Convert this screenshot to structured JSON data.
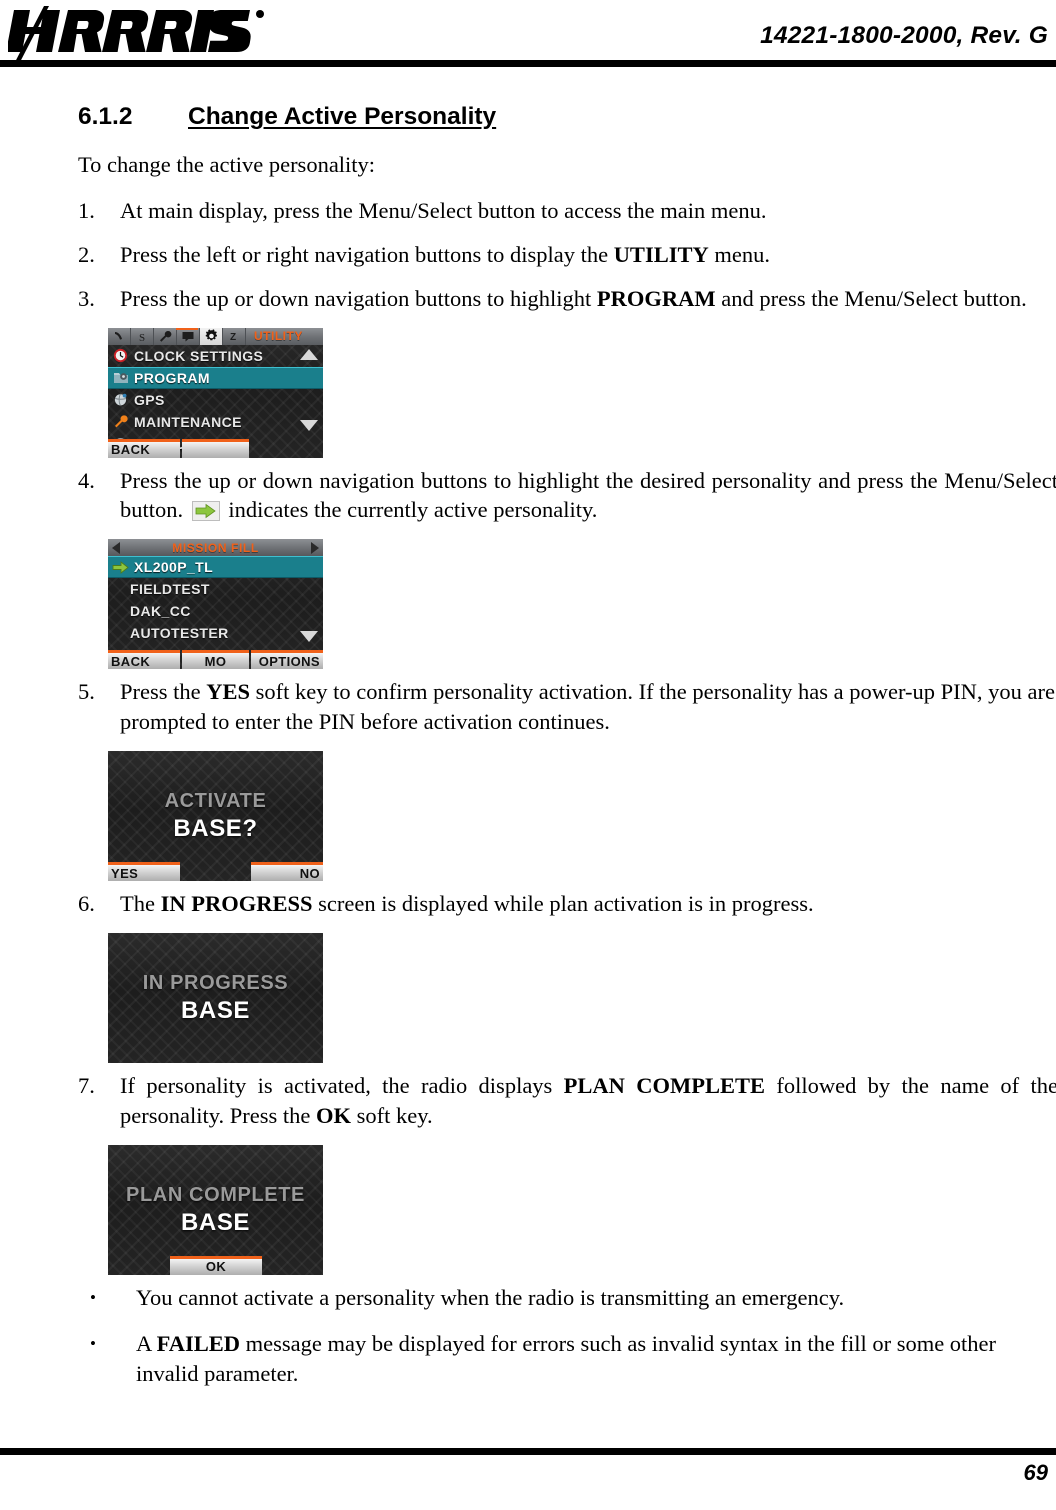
{
  "header": {
    "logo_text": "HARRIS",
    "logo_alt": "harris-logo",
    "document_number": "14221-1800-2000, Rev. G"
  },
  "footer": {
    "page_number": "69"
  },
  "section": {
    "number": "6.1.2",
    "title": "Change Active Personality",
    "intro": "To change the active personality:"
  },
  "steps": [
    {
      "num": "1.",
      "text": "At main display, press the Menu/Select button to access the main menu."
    },
    {
      "num": "2.",
      "pre": "Press the left or right navigation buttons to display the ",
      "bold": "UTILITY",
      "post": " menu."
    },
    {
      "num": "3.",
      "pre": "Press the up or down navigation buttons to highlight ",
      "bold": "PROGRAM",
      "post": " and press the Menu/Select button."
    },
    {
      "num": "4.",
      "pre": "Press the up or down navigation buttons to highlight the desired personality and press the Menu/Select button.  ",
      "post": " indicates the currently active personality."
    },
    {
      "num": "5.",
      "pre": "Press the ",
      "bold": "YES",
      "post": " soft key to confirm personality activation.  If the personality has a power-up PIN, you are prompted to enter the PIN before activation continues."
    },
    {
      "num": "6.",
      "pre": "The ",
      "bold": "IN PROGRESS",
      "post": " screen is displayed while plan activation is in progress."
    },
    {
      "num": "7.",
      "pre": "If personality is activated, the radio displays ",
      "bold": "PLAN COMPLETE",
      "post": " followed by the name of the personality. Press the ",
      "bold2": "OK",
      "post2": " soft key."
    }
  ],
  "bullets": [
    {
      "mark": "•",
      "text": "You cannot activate a personality when the radio is transmitting an emergency."
    },
    {
      "mark": "•",
      "pre": "A ",
      "bold": "FAILED",
      "post": " message may be displayed for errors such as invalid syntax in the fill or some other invalid parameter."
    }
  ],
  "radio_screens": {
    "utility_menu": {
      "title": "UTILITY",
      "tabs": [
        {
          "icon": "phone-icon",
          "active": false
        },
        {
          "icon": "contacts-icon",
          "active": false
        },
        {
          "icon": "wrench-icon",
          "active": false
        },
        {
          "icon": "message-icon",
          "active": false
        },
        {
          "icon": "gear-icon",
          "active": true
        },
        {
          "icon": "sleep-z-icon",
          "active": false
        }
      ],
      "items": [
        {
          "label": "CLOCK SETTINGS",
          "icon": "clock-icon",
          "selected": false
        },
        {
          "label": "PROGRAM",
          "icon": "program-folder-icon",
          "selected": true
        },
        {
          "label": "GPS",
          "icon": "globe-icon",
          "selected": false
        },
        {
          "label": "MAINTENANCE",
          "icon": "wrench-icon",
          "selected": false
        },
        {
          "label": "LANGUAGE",
          "icon": "language-icon",
          "selected": false
        }
      ],
      "scroll_up": "scroll-up-arrow",
      "scroll_down": "scroll-down-arrow",
      "softkeys": {
        "left": "BACK",
        "mid": "",
        "right": ""
      }
    },
    "mission_fill": {
      "title": "MISSION FILL",
      "items": [
        {
          "label": "XL200P_TL",
          "selected": true,
          "active_marker": true
        },
        {
          "label": "FIELDTEST",
          "selected": false,
          "active_marker": false
        },
        {
          "label": "DAK_CC",
          "selected": false,
          "active_marker": false
        },
        {
          "label": "AUTOTESTER",
          "selected": false,
          "active_marker": false
        }
      ],
      "softkeys": {
        "left": "BACK",
        "mid": "MO",
        "right": "OPTIONS"
      }
    },
    "activate": {
      "line1": "ACTIVATE",
      "line2": "BASE?",
      "softkeys": {
        "left": "YES",
        "right": "NO"
      }
    },
    "in_progress": {
      "line1": "IN PROGRESS",
      "line2": "BASE"
    },
    "plan_complete": {
      "line1": "PLAN COMPLETE",
      "line2": "BASE",
      "softkeys": {
        "center": "OK"
      }
    }
  },
  "colors": {
    "accent_orange": "#f0611a",
    "highlight_teal": "#1a7f8c",
    "active_green": "#8cc63f",
    "screen_bg": "#232323"
  }
}
